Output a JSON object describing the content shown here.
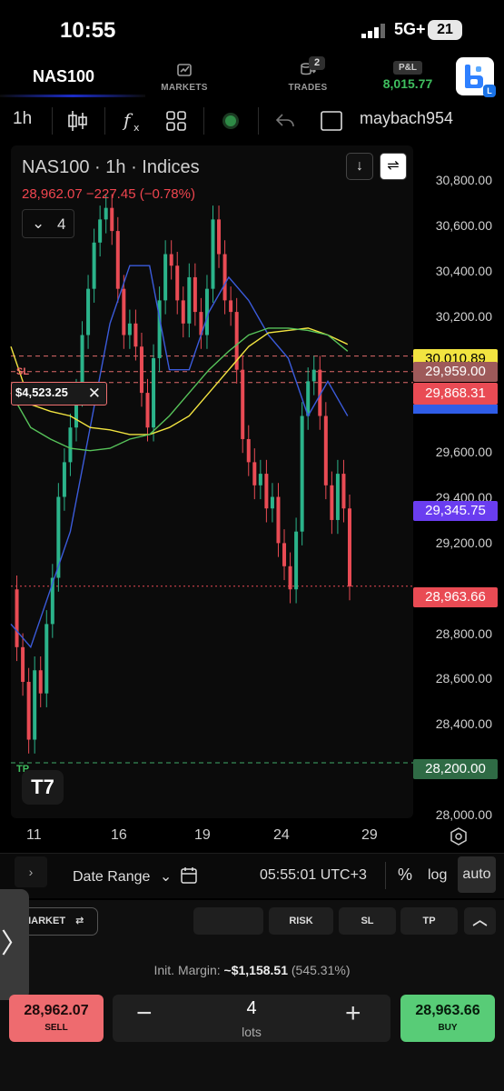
{
  "status_bar": {
    "time": "10:55",
    "network": "5G+",
    "battery": "21"
  },
  "header": {
    "symbol": "NAS100",
    "nav": [
      {
        "label": "MARKETS"
      },
      {
        "label": "TRADES",
        "badge": "2"
      }
    ],
    "pl": {
      "label": "P&L",
      "value": "8,015.77",
      "color": "#3fbf5f"
    },
    "logo_badge": "L"
  },
  "toolbar": {
    "interval": "1h",
    "username": "maybach954"
  },
  "chart": {
    "legend_title": "NAS100 · 1h · Indices",
    "legend_price": "28,962.07  −227.45 (−0.78%)",
    "indicator_count": "4",
    "sl_label": "SL",
    "tp_label": "TP",
    "order_amount": "$4,523.25",
    "price_tags": [
      {
        "value": "30,010.89",
        "bg": "#f2e440",
        "fg": "#000"
      },
      {
        "value": "29,959.00",
        "bg": "#9e5a5a",
        "fg": "#fff"
      },
      {
        "value": "29,868.31",
        "bg": "#e94b54",
        "fg": "#fff"
      },
      {
        "value": "29,345.75",
        "bg": "#6a3df0",
        "fg": "#fff"
      },
      {
        "value": "28,963.66",
        "bg": "#e94b54",
        "fg": "#fff"
      },
      {
        "value": "28,200.00",
        "bg": "#2f6b45",
        "fg": "#fff"
      }
    ]
  },
  "chart_data": {
    "type": "line",
    "title": "NAS100 · 1h · Indices",
    "x_tick_labels": [
      "11",
      "16",
      "19",
      "24",
      "29"
    ],
    "y_tick_labels": [
      "30,800.00",
      "30,600.00",
      "30,400.00",
      "30,200.00",
      "29,600.00",
      "29,400.00",
      "29,200.00",
      "28,800.00",
      "28,600.00",
      "28,400.00",
      "28,000.00"
    ],
    "ylim": [
      27960,
      30870
    ],
    "series": [
      {
        "color": "#e94b54",
        "x": [
          0,
          0.3,
          0.6,
          0.9,
          1.2,
          1.5,
          1.8,
          2.1,
          2.4,
          2.7,
          3.0,
          3.3,
          3.6,
          3.9,
          4.2,
          4.5,
          4.8,
          5.1,
          5.4,
          5.7,
          6.0,
          6.3,
          6.6,
          6.9,
          7.2,
          7.5,
          7.8,
          8.1,
          8.4,
          8.7,
          9.0,
          9.3,
          9.6,
          9.9,
          10.2,
          10.5,
          10.8,
          11.1,
          11.4,
          11.7,
          12.0,
          12.3,
          12.6,
          12.9,
          13.2,
          13.5,
          13.8,
          14.1,
          14.4,
          14.7,
          15.0,
          15.3,
          15.6,
          15.9,
          16.2,
          16.5,
          16.8,
          17.1
        ],
        "values": [
          28950,
          28700,
          28550,
          28300,
          28600,
          28500,
          28800,
          29000,
          29350,
          29500,
          29650,
          29800,
          30050,
          30250,
          30450,
          30550,
          30600,
          30500,
          30250,
          30050,
          30100,
          30000,
          29800,
          29650,
          29950,
          30200,
          30400,
          30350,
          30200,
          30100,
          30300,
          30150,
          30050,
          30250,
          30550,
          30400,
          30200,
          30150,
          29900,
          29600,
          29500,
          29400,
          29450,
          29300,
          29350,
          29150,
          29050,
          28950,
          29200,
          29700,
          29850,
          29900,
          29700,
          29400,
          29250,
          29450,
          29300,
          28963
        ]
      },
      {
        "color": "#3b5bdb",
        "x": [
          0,
          1,
          2,
          3,
          4,
          5,
          6,
          7,
          8,
          9,
          10,
          11,
          12,
          13,
          14,
          15,
          16,
          17
        ],
        "values": [
          28800,
          28700,
          28950,
          29200,
          29650,
          30100,
          30350,
          30350,
          29900,
          29900,
          30150,
          30300,
          30200,
          30050,
          29950,
          29700,
          29850,
          29700
        ]
      },
      {
        "color": "#f2e440",
        "x": [
          0,
          1,
          2,
          3,
          4,
          5,
          6,
          7,
          8,
          9,
          10,
          11,
          12,
          13,
          14,
          15,
          16,
          17
        ],
        "values": [
          30000,
          29750,
          29720,
          29700,
          29650,
          29640,
          29620,
          29620,
          29650,
          29700,
          29800,
          29900,
          30000,
          30060,
          30070,
          30080,
          30050,
          30010
        ]
      },
      {
        "color": "#57c35a",
        "x": [
          0,
          1,
          2,
          3,
          4,
          5,
          6,
          7,
          8,
          9,
          10,
          11,
          12,
          13,
          14,
          15,
          16,
          17
        ],
        "values": [
          29800,
          29650,
          29600,
          29560,
          29550,
          29560,
          29600,
          29620,
          29700,
          29800,
          29900,
          29980,
          30050,
          30080,
          30080,
          30070,
          30050,
          29980
        ]
      }
    ]
  },
  "bottom_bar": {
    "expand": "›",
    "date_range": "Date Range",
    "clock": "05:55:01 UTC+3",
    "percent": "%",
    "log": "log",
    "auto": "auto"
  },
  "trade_panel": {
    "order_type": "MARKET",
    "pills": [
      "RISK",
      "SL",
      "TP"
    ],
    "margin_label": "Init. Margin:",
    "margin_value": "~$1,158.51",
    "margin_pct": "(545.31%)",
    "sell_price": "28,962.07",
    "sell_label": "SELL",
    "buy_price": "28,963.66",
    "buy_label": "BUY",
    "quantity": "4",
    "quantity_unit": "lots"
  }
}
